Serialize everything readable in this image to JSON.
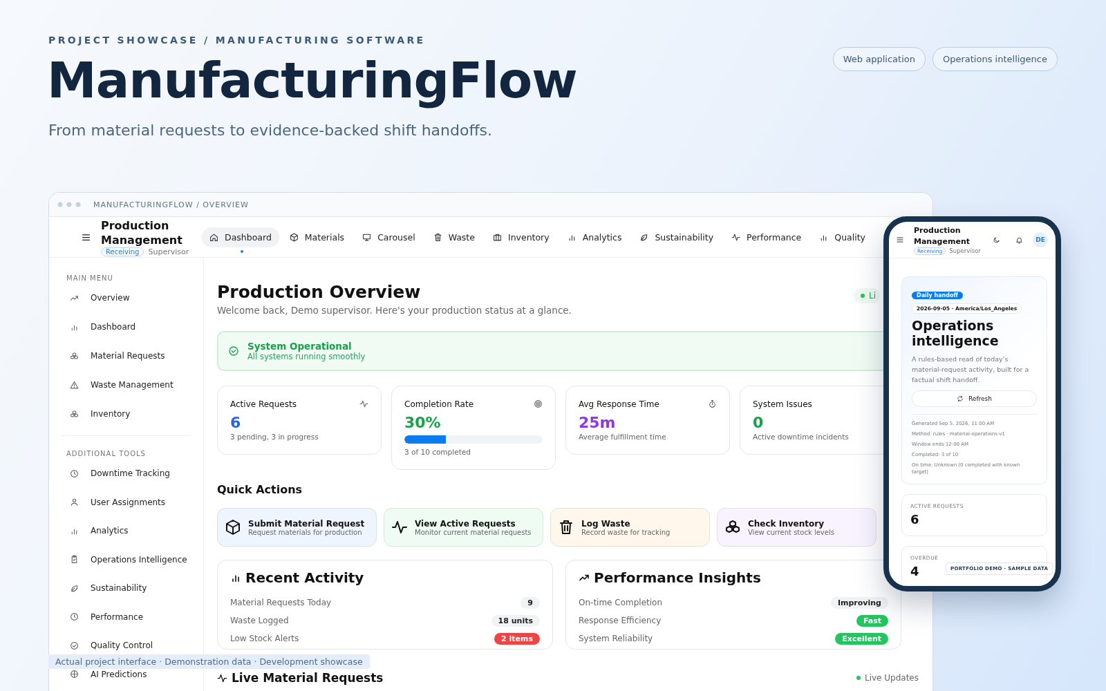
{
  "hero": {
    "eyebrow": "PROJECT SHOWCASE / MANUFACTURING SOFTWARE",
    "title": "ManufacturingFlow",
    "subtitle": "From material requests to evidence-backed shift handoffs.",
    "chips": [
      "Web application",
      "Operations intelligence"
    ]
  },
  "app": {
    "breadcrumb": "MANUFACTURINGFLOW / OVERVIEW",
    "header": {
      "title": "Production Management",
      "role_tag": "Receiving",
      "role": "Supervisor"
    },
    "nav": [
      {
        "label": "Dashboard",
        "selected": true
      },
      {
        "label": "Materials",
        "selected": false
      },
      {
        "label": "Carousel",
        "selected": false
      },
      {
        "label": "Waste",
        "selected": false
      },
      {
        "label": "Inventory",
        "selected": false
      },
      {
        "label": "Analytics",
        "selected": false
      },
      {
        "label": "Sustainability",
        "selected": false
      },
      {
        "label": "Performance",
        "selected": false
      },
      {
        "label": "Quality",
        "selected": false
      }
    ],
    "sidebar": {
      "sections": [
        {
          "title": "MAIN MENU",
          "items": [
            {
              "label": "Overview",
              "selected": false
            },
            {
              "label": "Dashboard",
              "selected": false
            },
            {
              "label": "Material Requests",
              "selected": false
            },
            {
              "label": "Waste Management",
              "selected": false
            },
            {
              "label": "Inventory",
              "selected": false
            }
          ]
        },
        {
          "title": "ADDITIONAL TOOLS",
          "items": [
            {
              "label": "Downtime Tracking",
              "selected": false
            },
            {
              "label": "User Assignments",
              "selected": false
            },
            {
              "label": "Analytics",
              "selected": false
            },
            {
              "label": "Operations Intelligence",
              "selected": false
            },
            {
              "label": "Sustainability",
              "selected": false
            },
            {
              "label": "Performance",
              "selected": false
            },
            {
              "label": "Quality Control",
              "selected": false
            },
            {
              "label": "AI Predictions",
              "selected": false
            }
          ]
        }
      ]
    },
    "page": {
      "title": "Production Overview",
      "subtitle": "Welcome back, Demo supervisor. Here's your production status at a glance.",
      "live_badge": "Li",
      "status": {
        "title": "System Operational",
        "subtitle": "All systems running smoothly"
      },
      "stats": [
        {
          "kind": "plain",
          "label": "Active Requests",
          "value": "6",
          "note": "3 pending, 3 in progress",
          "color": "#2563eb"
        },
        {
          "kind": "progress",
          "label": "Completion Rate",
          "value": "30%",
          "note": "3 of 10 completed",
          "color": "#16a34a",
          "level": 0.3
        },
        {
          "kind": "plain",
          "label": "Avg Response Time",
          "value": "25m",
          "note": "Average fulfillment time",
          "color": "#9333ea"
        },
        {
          "kind": "plain",
          "label": "System Issues",
          "value": "0",
          "note": "Active downtime incidents",
          "color": "#16a34a"
        }
      ],
      "quick_actions": {
        "title": "Quick Actions",
        "items": [
          {
            "title": "Submit Material Request",
            "subtitle": "Request materials for production",
            "color": "#eef5ff"
          },
          {
            "title": "View Active Requests",
            "subtitle": "Monitor current material requests",
            "color": "#effcf3"
          },
          {
            "title": "Log Waste",
            "subtitle": "Record waste for tracking",
            "color": "#fff7ec"
          },
          {
            "title": "Check Inventory",
            "subtitle": "View current stock levels",
            "color": "#f8f3ff"
          }
        ]
      },
      "panels": [
        {
          "title": "Recent Activity",
          "rows": [
            {
              "label": "Material Requests Today",
              "value": "9",
              "kind": "neutral"
            },
            {
              "label": "Waste Logged",
              "value": "18 units",
              "kind": "neutral"
            },
            {
              "label": "Low Stock Alerts",
              "value": "2 items",
              "kind": "danger"
            }
          ]
        },
        {
          "title": "Performance Insights",
          "rows": [
            {
              "label": "On-time Completion",
              "value": "Improving",
              "kind": "neutral"
            },
            {
              "label": "Response Efficiency",
              "value": "Fast",
              "kind": "success"
            },
            {
              "label": "System Reliability",
              "value": "Excellent",
              "kind": "success"
            }
          ]
        }
      ],
      "live_section": {
        "title": "Live Material Requests",
        "status": "Live Updates"
      }
    }
  },
  "caption": "Actual project interface · Demonstration data · Development showcase",
  "phone": {
    "header": {
      "title": "Production Management",
      "role_tag": "Receiving",
      "role": "Supervisor",
      "avatar": "DE"
    },
    "handoff": {
      "badge": "Daily handoff",
      "date": "2026-09-05 · America/Los_Angeles",
      "title": "Operations intelligence",
      "description": "A rules-based read of today’s material-request activity, built for a factual shift handoff.",
      "button": "Refresh",
      "meta": [
        "Generated Sep 5, 2026, 11:00 AM",
        "Method: rules · material-operations-v1",
        "Window ends 12:00 AM",
        "Completed: 3 of 10",
        "On time: Unknown (0 completed with known target)"
      ]
    },
    "metrics": [
      {
        "label": "ACTIVE REQUESTS",
        "value": "6"
      },
      {
        "label": "OVERDUE",
        "value": "4"
      }
    ],
    "badge": "PORTFOLIO DEMO · SAMPLE DATA"
  }
}
